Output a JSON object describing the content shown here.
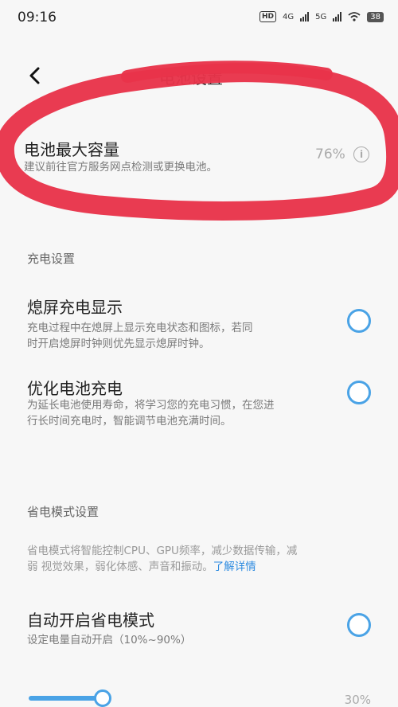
{
  "status_bar": {
    "time": "09:16",
    "hd": "HD",
    "net1": "4G",
    "net2": "5G",
    "battery": "38"
  },
  "header": {
    "back_icon": "chevron-left-icon",
    "title": "电池设置"
  },
  "battery_capacity": {
    "title": "电池最大容量",
    "desc": "建议前往官方服务网点检测或更换电池。",
    "value": "76%",
    "info_icon": "info-icon"
  },
  "charging_section": {
    "title": "充电设置",
    "items": [
      {
        "title": "熄屏充电显示",
        "desc_line1": "充电过程中在熄屏上显示充电状态和图标，若同",
        "desc_line2": "时开启熄屏时钟则优先显示熄屏时钟。"
      },
      {
        "title": "优化电池充电",
        "desc_line1": "为延长电池使用寿命，将学习您的充电习惯，在您进",
        "desc_line2": "行长时间充电时，智能调节电池充满时间。"
      }
    ]
  },
  "power_saving_section": {
    "title": "省电模式设置",
    "desc_line1": "省电模式将智能控制CPU、GPU频率，减少数据传输，减",
    "desc_line2": "弱 视觉效果，弱化体感、声音和振动。",
    "link": "了解详情",
    "auto_item": {
      "title": "自动开启省电模式",
      "desc": "设定电量自动开启（10%~90%）"
    },
    "slider_value_label": "30%"
  },
  "colors": {
    "accent": "#4aa3e6",
    "annotation": "#e8334a",
    "background": "#f7f7f7"
  }
}
